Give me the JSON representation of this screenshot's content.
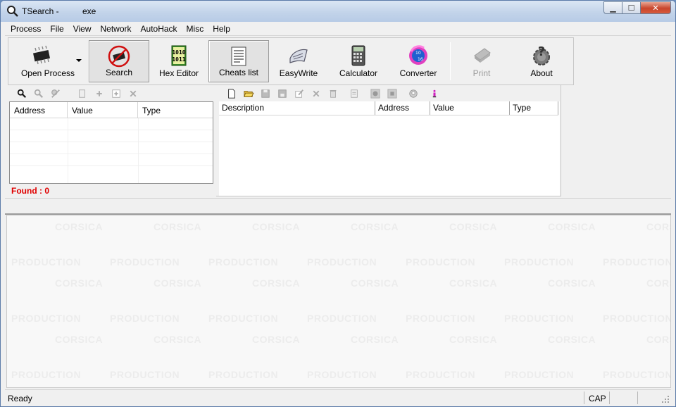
{
  "titlebar": {
    "app_name": "TSearch -",
    "process_name": "exe",
    "minimize": "▁",
    "maximize": "☐",
    "close": "✕"
  },
  "menu": [
    "Process",
    "File",
    "View",
    "Network",
    "AutoHack",
    "Misc",
    "Help"
  ],
  "toolbar": {
    "open_process": "Open Process",
    "search": "Search",
    "hex_editor": "Hex Editor",
    "cheats_list": "Cheats list",
    "easywrite": "EasyWrite",
    "calculator": "Calculator",
    "converter": "Converter",
    "print": "Print",
    "about": "About"
  },
  "address_panel": {
    "columns": [
      "Address",
      "Value",
      "Type"
    ],
    "found_label": "Found : 0"
  },
  "cheats_panel": {
    "columns": [
      "Description",
      "Address",
      "Value",
      "Type"
    ]
  },
  "watermark": {
    "line_a": "CORSICA",
    "line_b": "PRODUCTION"
  },
  "statusbar": {
    "text": "Ready",
    "cap": "CAP"
  },
  "colors": {
    "found": "#e00000",
    "accent": "#2a6ac8"
  }
}
